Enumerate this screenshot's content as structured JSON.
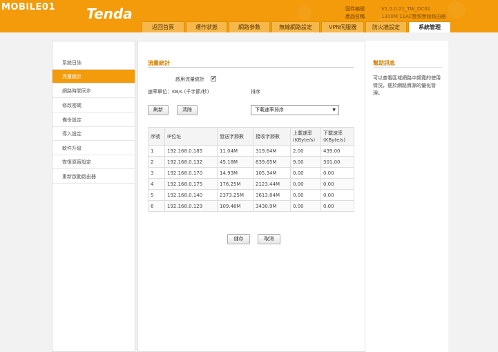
{
  "header": {
    "site_logo": "MOBILE01",
    "brand": "Tenda",
    "firmware_label": "固件編號",
    "firmware_value": "V1.2.0.21_TW_DC01",
    "product_label": "產品名稱",
    "product_value": "1200M 11AC雙頻無線路由器"
  },
  "tabs": [
    {
      "label": "返回首頁"
    },
    {
      "label": "運作狀態"
    },
    {
      "label": "網路參數"
    },
    {
      "label": "無線網路設定"
    },
    {
      "label": "VPN伺服器"
    },
    {
      "label": "防火牆設定"
    },
    {
      "label": "系統管理"
    }
  ],
  "sidebar": {
    "items": [
      {
        "label": "系統日誌"
      },
      {
        "label": "流量統計"
      },
      {
        "label": "網路時間同步"
      },
      {
        "label": "修改密碼"
      },
      {
        "label": "備份設定"
      },
      {
        "label": "導入設定"
      },
      {
        "label": "軟件升級"
      },
      {
        "label": "恢復原廠設定"
      },
      {
        "label": "重新啟動路由器"
      }
    ]
  },
  "main": {
    "title": "流量統計",
    "enable_label": "啟用流量統計",
    "enable_checked": "✔",
    "rate_unit": "速率單位：KB/s (千字節/秒)",
    "sort_label": "排序",
    "refresh_button": "刷新",
    "clear_button": "清除",
    "sort_select_value": "下載速率排序",
    "save_button": "儲存",
    "cancel_button": "取消"
  },
  "table": {
    "headers": [
      "序號",
      "IP位址",
      "發送字節數",
      "接收字節數",
      "上載速率\n(KByte/s)",
      "下載速率\n(KByte/s)"
    ],
    "rows": [
      [
        "1",
        "192.168.0.185",
        "11.04M",
        "319.64M",
        "2.00",
        "439.00"
      ],
      [
        "2",
        "192.168.0.132",
        "45.18M",
        "839.65M",
        "9.00",
        "301.00"
      ],
      [
        "3",
        "192.168.0.170",
        "14.93M",
        "105.34M",
        "0.00",
        "0.00"
      ],
      [
        "4",
        "192.168.0.175",
        "176.25M",
        "2123.44M",
        "0.00",
        "0.00"
      ],
      [
        "5",
        "192.168.0.140",
        "2373.25M",
        "3613.84M",
        "0.00",
        "0.00"
      ],
      [
        "6",
        "192.168.0.129",
        "109.46M",
        "3430.9M",
        "0.00",
        "0.00"
      ]
    ]
  },
  "help": {
    "title": "幫助訊息",
    "text": "可以查看區域網路中頻寬的使用情況，便於網路資源的優化管理。"
  },
  "colors": {
    "accent": "#f39b0a",
    "title": "#d87f00"
  }
}
